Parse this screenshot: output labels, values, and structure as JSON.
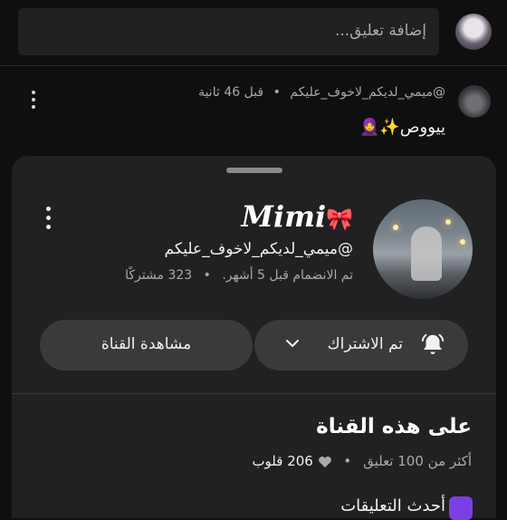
{
  "composer": {
    "placeholder": "إضافة تعليق...",
    "avatar_icon": "user-avatar"
  },
  "comment": {
    "author": "@ميمي_لديكم_لاخوف_عليكم",
    "separator": "•",
    "time": "قبل 46 ثانية",
    "text": "ييووص✨🧕",
    "menu_icon": "more-vert-icon"
  },
  "sheet": {
    "channel_name": "Mimi",
    "channel_name_decoration": "🎀",
    "handle": "@ميمي_لديكم_لاخوف_عليكم",
    "joined": "تم الانضمام قبل 5 أشهر.",
    "separator": "•",
    "subscribers": "323 مشتركًا",
    "subscribe_button": "تم الاشتراك",
    "view_channel_button": "مشاهدة القناة",
    "about_title": "على هذه القناة",
    "comments_stat": "أكثر من 100 تعليق",
    "hearts_stat": "206 قلوب",
    "next_row_text": "أحدث التعليقات",
    "colors": {
      "accent_purple": "#7b3fe4",
      "sheet_bg": "#212121",
      "button_bg": "#3a3a3a"
    }
  }
}
